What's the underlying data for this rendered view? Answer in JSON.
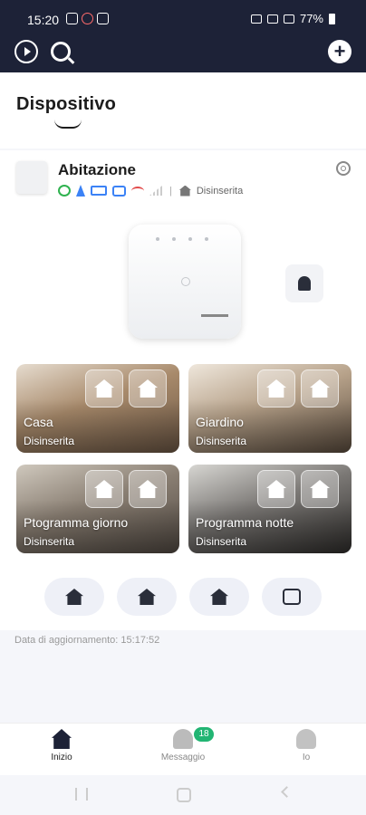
{
  "status_bar": {
    "time": "15:20",
    "battery_percent": "77%"
  },
  "header": {
    "title": "Dispositivo"
  },
  "device": {
    "name": "Abitazione",
    "status_text": "Disinserita",
    "status_icons": [
      "check-ok-icon",
      "power-icon",
      "battery-icon",
      "router-icon",
      "wifi-off-icon",
      "cellular-icon",
      "house-icon"
    ]
  },
  "scenes": [
    {
      "name": "Casa",
      "state": "Disinserita"
    },
    {
      "name": "Giardino",
      "state": "Disinserita"
    },
    {
      "name": "Ptogramma giorno",
      "state": "Disinserita"
    },
    {
      "name": "Programma notte",
      "state": "Disinserita"
    }
  ],
  "actions": [
    "away-arm-icon",
    "stay-arm-icon",
    "disarm-icon",
    "clear-alarm-icon"
  ],
  "update_text": "Data di aggiornamento: 15:17:52",
  "bottom_nav": {
    "items": [
      {
        "label": "Inizio",
        "icon": "home-icon",
        "active": true
      },
      {
        "label": "Messaggio",
        "icon": "bell-icon",
        "badge": "18"
      },
      {
        "label": "Io",
        "icon": "person-icon"
      }
    ]
  },
  "colors": {
    "header_bg": "#1d2237",
    "accent_green": "#22b573",
    "page_bg": "#f5f6fa"
  }
}
